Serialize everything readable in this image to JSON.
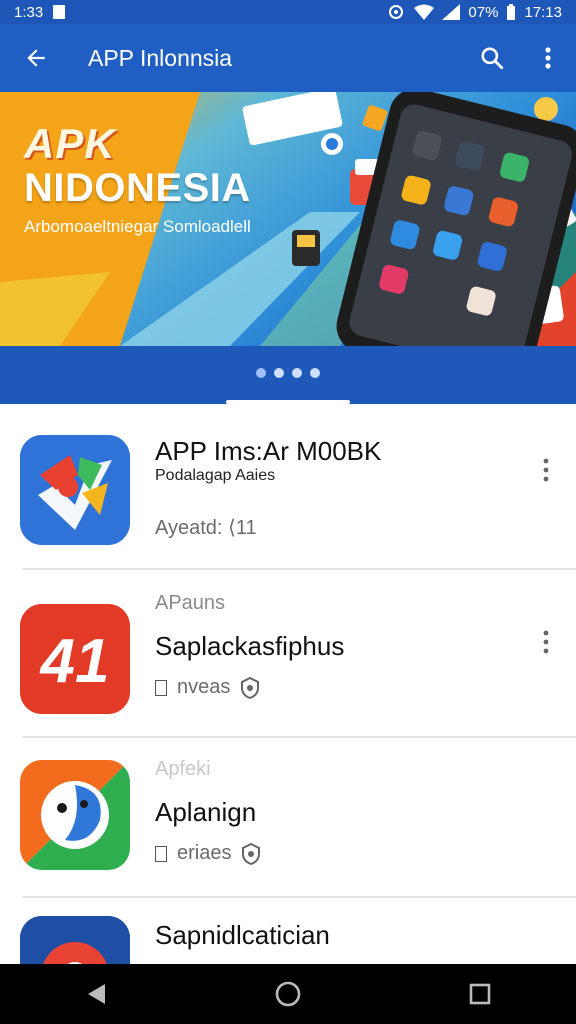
{
  "status_bar": {
    "time_left": "1:33",
    "battery": "07%",
    "time_right": "17:13"
  },
  "app_bar": {
    "title": "APP Inlonnsia"
  },
  "banner": {
    "headline": "APK",
    "name": "NIDONESIA",
    "subtitle": "Arbomoaeltniegar Somloadlell",
    "indicator_dots": 4,
    "active_dot": 1
  },
  "apps": [
    {
      "title": "APP Ims:Ar M00BK",
      "subtitle": "Podalagap Aaies",
      "meta": "Ayeatd: ⟨11",
      "icon": "colorful-arrow-app-icon",
      "accent": "#2f73d8"
    },
    {
      "overline": "APauns",
      "title": "Saplackasfiphus",
      "meta": "nveas",
      "icon": "red-number-app-icon",
      "accent": "#e23a26"
    },
    {
      "overline": "Apfeki",
      "title": "Aplanign",
      "meta": "eriaes",
      "icon": "bird-app-icon",
      "accent": "#f36b1c"
    },
    {
      "title": "Sapnidlcatician",
      "icon": "chrome-like-app-icon",
      "accent": "#1e4fa5"
    }
  ],
  "colors": {
    "primary": "#1f5fc4",
    "status": "#1e57b8"
  }
}
